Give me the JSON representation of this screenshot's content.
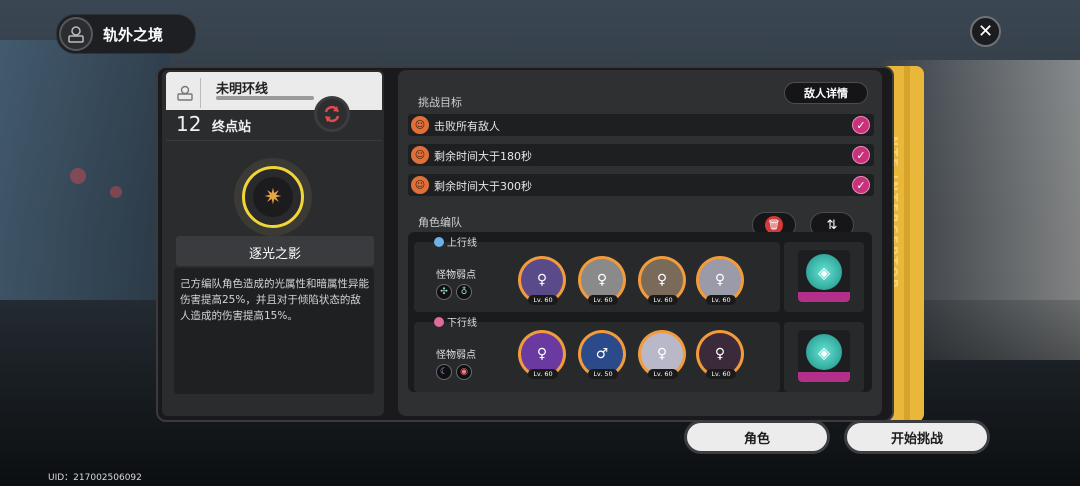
{
  "header": {
    "title": "轨外之境",
    "close_icon": "✕"
  },
  "stage": {
    "name": "未明环线",
    "floor_number": "12",
    "floor_name": "终点站"
  },
  "spine": {
    "text": "NTE INTERCEPTOR"
  },
  "buff": {
    "title": "逐光之影",
    "description": "己方编队角色造成的光属性和暗属性异能伤害提高25%，并且对于倾陷状态的敌人造成的伤害提高15%。"
  },
  "objectives": {
    "label": "挑战目标",
    "enemy_details_label": "敌人详情",
    "items": [
      {
        "text": "击败所有敌人"
      },
      {
        "text": "剩余时间大于180秒"
      },
      {
        "text": "剩余时间大于300秒"
      }
    ]
  },
  "team": {
    "label": "角色编队",
    "lanes": [
      {
        "name": "上行线",
        "tag_color": "#6fb0e8",
        "weak_label": "怪物弱点",
        "weak_icons": [
          "✣",
          "♁"
        ],
        "members": [
          {
            "lv": "Lv. 60",
            "color": "#5a4a8a"
          },
          {
            "lv": "Lv. 60",
            "color": "#8a8a8a"
          },
          {
            "lv": "Lv. 60",
            "color": "#7a6a5a"
          },
          {
            "lv": "Lv. 60",
            "color": "#9a9aa8"
          }
        ]
      },
      {
        "name": "下行线",
        "tag_color": "#e06a9a",
        "weak_label": "怪物弱点",
        "weak_icons": [
          "☾",
          "◉"
        ],
        "members": [
          {
            "lv": "Lv. 60",
            "color": "#6a3aa0"
          },
          {
            "lv": "Lv. 50",
            "color": "#2a4a8a"
          },
          {
            "lv": "Lv. 60",
            "color": "#b8b8c8"
          },
          {
            "lv": "Lv. 60",
            "color": "#3a2a3a"
          }
        ]
      }
    ]
  },
  "buttons": {
    "character": "角色",
    "start": "开始挑战"
  },
  "footer": {
    "uid": "UID：217002506092"
  }
}
